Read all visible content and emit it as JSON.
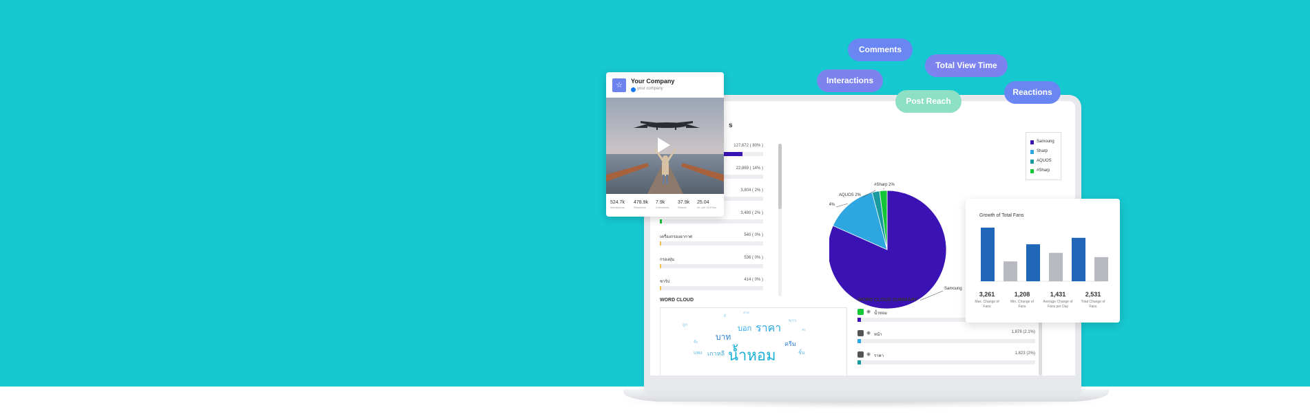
{
  "colors": {
    "background": "#16c8d0",
    "pill_blue": "#6a86f3",
    "pill_purple": "#7c82ee",
    "pill_green": "#8ee0c5",
    "samsung": "#3b12b4",
    "sharp": "#2ea6df",
    "aquos": "#189a9e",
    "hashtag_sharp": "#13c636",
    "growth_max": "#2167b9",
    "growth_gray": "#b6b9bf"
  },
  "pills": {
    "comments": "Comments",
    "interactions": "Interactions",
    "total_view_time": "Total View Time",
    "post_reach": "Post Reach",
    "reactions": "Reactions"
  },
  "post_card": {
    "avatar_icon": "star-icon",
    "company": "Your Company",
    "handle": "your company",
    "play_icon": "play-icon",
    "stats": [
      {
        "value": "524.7k",
        "label": "Interactions"
      },
      {
        "value": "478.9k",
        "label": "Reactions"
      },
      {
        "value": "7.9k",
        "label": "Comments"
      },
      {
        "value": "37.9k",
        "label": "Shares"
      },
      {
        "value": "25.04",
        "label": "Int. per 1k Fans"
      }
    ]
  },
  "dashboard": {
    "title": "s",
    "ranking": [
      {
        "name": "",
        "value": "127,672 ( 80% )",
        "fraction": 0.8,
        "color": "#3b12b4"
      },
      {
        "name": "",
        "value": "22,869 ( 14% )",
        "fraction": 0.14,
        "color": "#2ea6df"
      },
      {
        "name": "",
        "value": "3,804 ( 2% )",
        "fraction": 0.02,
        "color": "#189a9e"
      },
      {
        "name": "",
        "value": "3,480 ( 2% )",
        "fraction": 0.02,
        "color": "#13c636"
      },
      {
        "name": "เครื่องกรองอากาศ",
        "value": "540 ( 0% )",
        "fraction": 0.005,
        "color": "#f2c14e"
      },
      {
        "name": "กรองฝุ่น",
        "value": "536 ( 0% )",
        "fraction": 0.005,
        "color": "#f2c14e"
      },
      {
        "name": "ชาร์ป",
        "value": "414 ( 0% )",
        "fraction": 0.005,
        "color": "#f2c14e"
      }
    ],
    "word_cloud_title": "WORD CLOUD",
    "word_cloud": [
      {
        "text": "น้ำหอม",
        "size": 22,
        "color": "#1ab1d9"
      },
      {
        "text": "ราคา",
        "size": 16,
        "color": "#2aa9e3"
      },
      {
        "text": "บาท",
        "size": 12,
        "color": "#2f7fd0"
      },
      {
        "text": "บอก",
        "size": 11,
        "color": "#2aa9e3"
      },
      {
        "text": "ครีม",
        "size": 9,
        "color": "#2f7fd0"
      },
      {
        "text": "เกาหลี",
        "size": 9,
        "color": "#4aaed8"
      },
      {
        "text": "แพง",
        "size": 7,
        "color": "#5ab6e8"
      },
      {
        "text": "ชิ้น",
        "size": 7,
        "color": "#5ab6e8"
      },
      {
        "text": "ขาว",
        "size": 6,
        "color": "#7cc2ea"
      },
      {
        "text": "ถูก",
        "size": 6,
        "color": "#7cc2ea"
      },
      {
        "text": "ซื้อ",
        "size": 5,
        "color": "#8ccbee"
      },
      {
        "text": "ส่ง",
        "size": 5,
        "color": "#8ccbee"
      },
      {
        "text": "สวย",
        "size": 5,
        "color": "#8ccbee"
      },
      {
        "text": "ดี",
        "size": 5,
        "color": "#8ccbee"
      }
    ],
    "summary_title": "WORD CLOUD SUMMARY",
    "summary": [
      {
        "label": "น้ำหอม",
        "value": "2,330 (2.1%)",
        "fraction": 0.021,
        "color": "#3b12b4",
        "icon_color": "#13c636",
        "icon": "tag-icon"
      },
      {
        "label": "หน้า",
        "value": "1,878 (2.1%)",
        "fraction": 0.021,
        "color": "#2ea6df",
        "icon_color": "#555555",
        "icon": "tag-icon"
      },
      {
        "label": "ราคา",
        "value": "1,823 (2%)",
        "fraction": 0.02,
        "color": "#189a9e",
        "icon_color": "#555555",
        "icon": "tag-icon"
      }
    ]
  },
  "chart_data": [
    {
      "type": "pie",
      "labels": [
        "Samoung",
        "Sharp",
        "AQUOS",
        "#Sharp"
      ],
      "values": [
        80,
        14,
        2,
        2
      ],
      "slice_labels": [
        "Samoung",
        "Sharp 14%",
        "AQUOS 2%",
        "#Sharp 2%"
      ],
      "legend": [
        "Samoung",
        "Sharp",
        "AQUOS",
        "#Sharp"
      ],
      "legend_position": "top-right",
      "colors": [
        "#3b12b4",
        "#2ea6df",
        "#189a9e",
        "#13c636"
      ]
    },
    {
      "type": "bar",
      "title": "Growth of Total Fans",
      "categories": [
        "Max. Change of Fans",
        "Min. Change of Fans",
        "Average Change of Fans per Day",
        "Total Change of Fans"
      ],
      "values": [
        3261,
        1208,
        1431,
        2531
      ],
      "bars": [
        100,
        37,
        69,
        53,
        81,
        45
      ],
      "bar_colors": [
        "#2167b9",
        "#b6b9bf",
        "#2167b9",
        "#b6b9bf",
        "#2167b9",
        "#b6b9bf"
      ],
      "stat_values": [
        "3,261",
        "1,208",
        "1,431",
        "2,531"
      ],
      "stat_labels": [
        "Max. Change of Fans",
        "Min. Change of Fans",
        "Average Change of Fans per Day",
        "Total Change of Fans"
      ]
    }
  ]
}
